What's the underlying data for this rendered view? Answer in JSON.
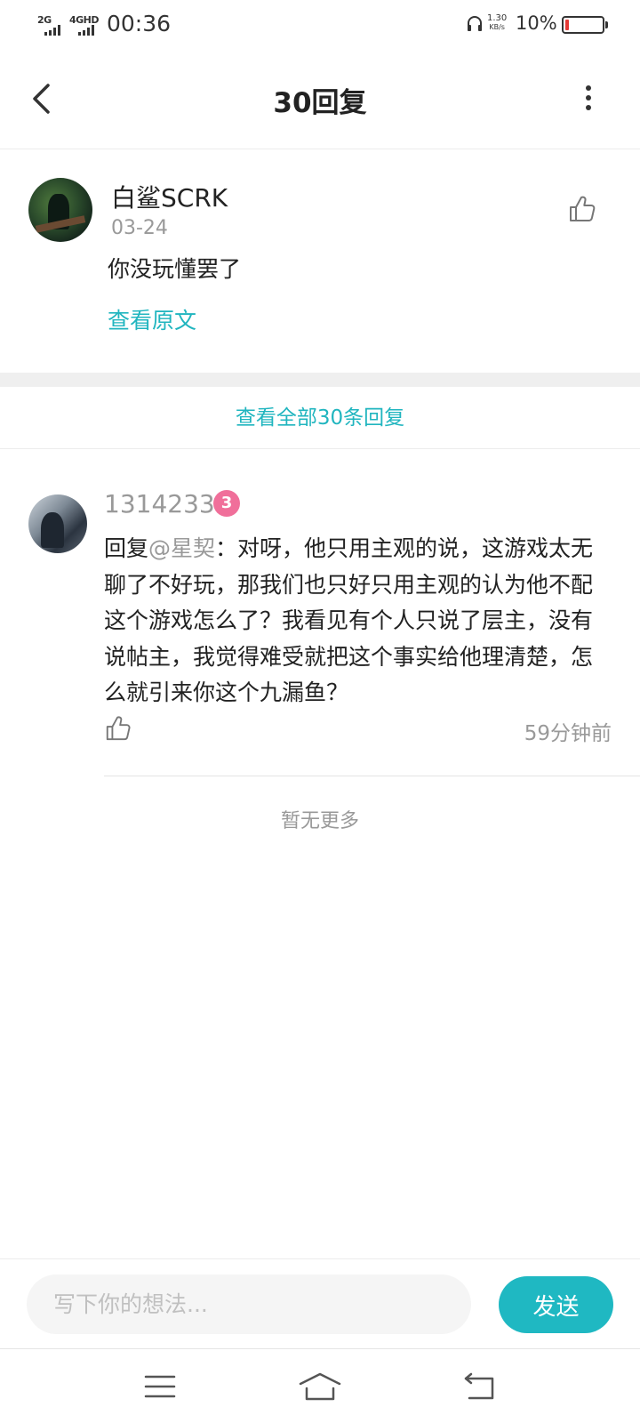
{
  "status_bar": {
    "signal1_label": "2G",
    "signal2_label": "4GHD",
    "time": "00:36",
    "net_speed_value": "1.30",
    "net_speed_unit": "KB/s",
    "battery_percent": "10%",
    "battery_level": 0.1,
    "battery_color": "#e53935"
  },
  "header": {
    "title": "30回复",
    "back_icon": "chevron-left-icon",
    "more_icon": "more-vertical-icon"
  },
  "original_comment": {
    "username": "白鲨SCRK",
    "date": "03-24",
    "text": "你没玩懂罢了",
    "view_original_label": "查看原文",
    "like_icon": "thumbs-up-icon"
  },
  "view_all_label": "查看全部30条回复",
  "reply": {
    "username": "1314233",
    "level_badge": "3",
    "prefix": "回复",
    "mention": "@星契",
    "text": "：对呀，他只用主观的说，这游戏太无聊了不好玩，那我们也只好只用主观的认为他不配这个游戏怎么了？我看见有个人只说了层主，没有说帖主，我觉得难受就把这个事实给他理清楚，怎么就引来你这个九漏鱼？",
    "time": "59分钟前",
    "like_icon": "thumbs-up-icon"
  },
  "no_more_label": "暂无更多",
  "input_bar": {
    "placeholder": "写下你的想法...",
    "value": "",
    "send_label": "发送"
  },
  "nav_bar": {
    "menu_icon": "menu-icon",
    "home_icon": "home-icon",
    "back_icon": "back-arrow-icon"
  },
  "colors": {
    "accent": "#1fb8c2",
    "link": "#20b5bf",
    "badge": "#f06f9a"
  }
}
